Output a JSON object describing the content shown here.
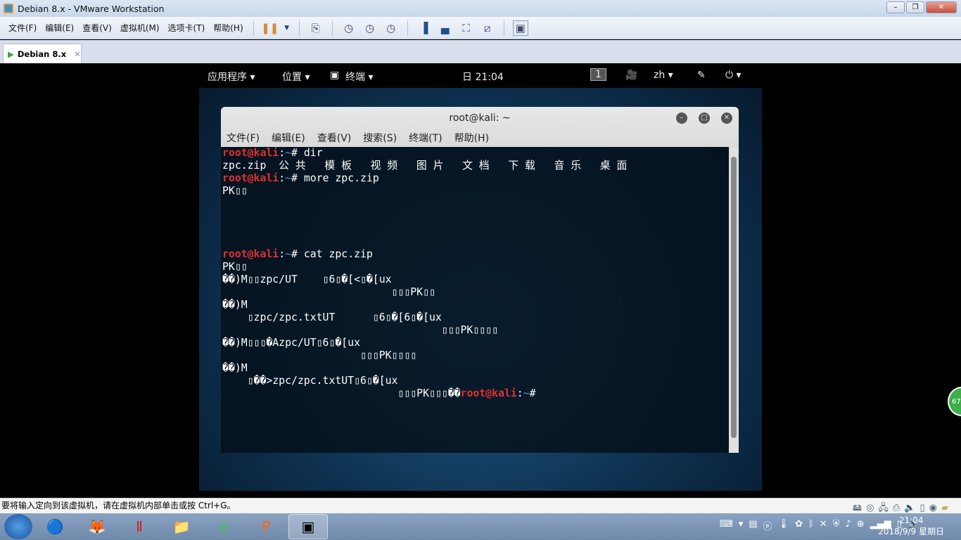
{
  "window": {
    "title": "Debian 8.x - VMware Workstation",
    "buttons": [
      "–",
      "❐",
      "✕"
    ]
  },
  "menu": [
    "文件(F)",
    "编辑(E)",
    "查看(V)",
    "虚拟机(M)",
    "选项卡(T)",
    "帮助(H)"
  ],
  "toolbar_icons": [
    "pause-icon",
    "dropdown-icon",
    "send-ctrl-alt-del-icon",
    "snapshot-take-icon",
    "snapshot-revert-icon",
    "snapshot-manager-icon",
    "sidebar-icon",
    "console-view-icon",
    "fullscreen-icon",
    "unity-icon",
    "thumbnail-view-icon"
  ],
  "tab": {
    "label": "Debian 8.x",
    "close": "✕"
  },
  "gnome": {
    "apps": "应用程序 ▾",
    "places": "位置 ▾",
    "terminal": "终端 ▾",
    "clock": "日 21:04",
    "workspace": "1",
    "lang": "zh ▾",
    "power": "⏻ ▾"
  },
  "terminal": {
    "title": "root@kali: ~",
    "menu": [
      "文件(F)",
      "编辑(E)",
      "查看(V)",
      "搜索(S)",
      "终端(T)",
      "帮助(H)"
    ],
    "lines": [
      [
        [
          "root@kali",
          "red"
        ],
        [
          ":",
          ""
        ],
        [
          "~",
          "blue"
        ],
        [
          "# dir",
          ""
        ]
      ],
      [
        [
          "zpc.zip  公 共   模 板   视 频   图 片   文 档   下 载   音 乐   桌 面",
          ""
        ]
      ],
      [
        [
          "root@kali",
          "red"
        ],
        [
          ":",
          ""
        ],
        [
          "~",
          "blue"
        ],
        [
          "# more zpc.zip",
          ""
        ]
      ],
      [
        [
          "PK▯▯",
          ""
        ]
      ],
      [],
      [],
      [],
      [],
      [
        [
          "root@kali",
          "red"
        ],
        [
          ":",
          ""
        ],
        [
          "~",
          "blue"
        ],
        [
          "# cat zpc.zip",
          ""
        ]
      ],
      [
        [
          "PK▯▯",
          ""
        ]
      ],
      [
        [
          "��)M▯▯zpc/UT    ▯6▯�[<▯�[ux",
          ""
        ]
      ],
      [
        [
          "                           ▯▯▯PK▯▯",
          ""
        ]
      ],
      [
        [
          "��)M",
          ""
        ]
      ],
      [
        [
          "    ▯zpc/zpc.txtUT      ▯6▯�[6▯�[ux",
          ""
        ]
      ],
      [
        [
          "                                   ▯▯▯PK▯▯▯▯",
          ""
        ]
      ],
      [
        [
          "��)M▯▯▯�Azpc/UT▯6▯�[ux",
          ""
        ]
      ],
      [
        [
          "                      ▯▯▯PK▯▯▯▯",
          ""
        ]
      ],
      [
        [
          "��)M",
          ""
        ]
      ],
      [
        [
          "    ▯��>zpc/zpc.txtUT▯6▯�[ux",
          ""
        ]
      ],
      [
        [
          "                            ▯▯▯PK▯▯▯��",
          ""
        ],
        [
          "root@kali",
          "red"
        ],
        [
          ":",
          ""
        ],
        [
          "~",
          "blue"
        ],
        [
          "#",
          ""
        ]
      ]
    ]
  },
  "status": {
    "message": "要将输入定向到该虚拟机，请在虚拟机内部单击或按 Ctrl+G。"
  },
  "taskbar": {
    "clock_time": "21:04",
    "clock_date": "2018/9/9 星期日",
    "badge": "67"
  }
}
